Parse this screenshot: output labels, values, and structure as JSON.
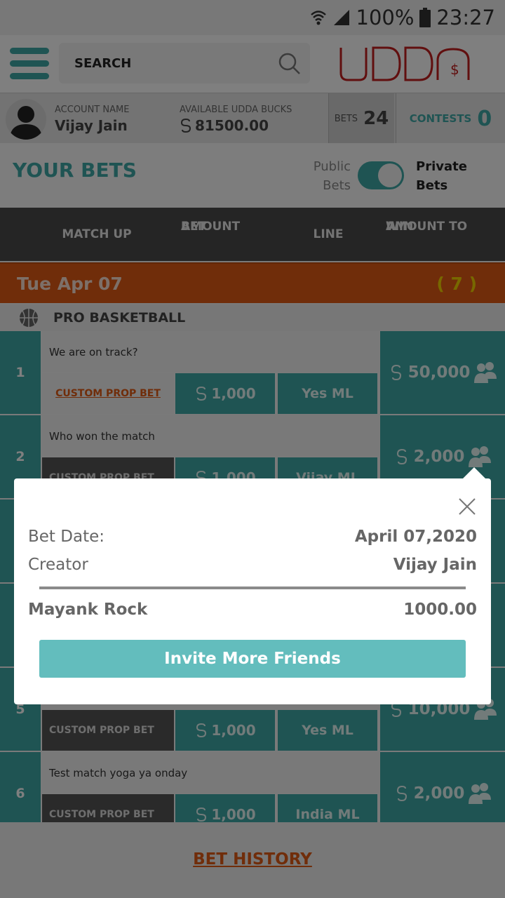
{
  "status_bar": {
    "battery": "100%",
    "time": "23:27"
  },
  "header": {
    "search_placeholder": "SEARCH",
    "logo_text": "UDDA"
  },
  "account": {
    "name_label": "ACCOUNT NAME",
    "name": "Vijay Jain",
    "bucks_label": "AVAILABLE UDDA BUCKS",
    "bucks": "81500.00",
    "bets_label": "BETS",
    "bets_count": "24",
    "contests_label": "CONTESTS",
    "contests_count": "0"
  },
  "your_bets": {
    "title": "YOUR BETS",
    "public_line1": "Public",
    "public_line2": "Bets",
    "private_line1": "Private",
    "private_line2": "Bets",
    "toggle_on": true
  },
  "columns": {
    "matchup": "MATCH UP",
    "amount_bet_1": "AMOUNT",
    "amount_bet_2": "BET",
    "line": "LINE",
    "amount_win_1": "AMOUNT TO",
    "amount_win_2": "WIN"
  },
  "date_group": {
    "date": "Tue Apr 07",
    "count": "( 7 )"
  },
  "sport": {
    "name": "PRO BASKETBALL"
  },
  "rows": [
    {
      "num": "1",
      "question": "We are on track?",
      "type": "CUSTOM PROP BET",
      "amount": "1,000",
      "line": "Yes ML",
      "win": "50,000"
    },
    {
      "num": "2",
      "question": "Who won the match",
      "type": "CUSTOM PROP BET",
      "amount": "1,000",
      "line": "Vijay ML",
      "win": "2,000"
    },
    {
      "num": "5",
      "question": "",
      "type": "CUSTOM PROP BET",
      "amount": "1,000",
      "line": "Yes ML",
      "win": "10,000"
    },
    {
      "num": "6",
      "question": "Test match yoga ya onday",
      "type": "CUSTOM PROP BET",
      "amount": "1,000",
      "line": "India ML",
      "win": "2,000"
    }
  ],
  "footer": {
    "bet_history": "BET HISTORY"
  },
  "popup": {
    "bet_date_label": "Bet Date:",
    "bet_date": "April 07,2020",
    "creator_label": "Creator",
    "creator": "Vijay Jain",
    "participant_name": "Mayank Rock",
    "participant_amount": "1000.00",
    "invite_label": "Invite More Friends"
  },
  "colors": {
    "teal": "#3fa9a6",
    "orange": "#e05a14",
    "dark": "#4a4a4a",
    "popup_button": "#63bdbd"
  }
}
